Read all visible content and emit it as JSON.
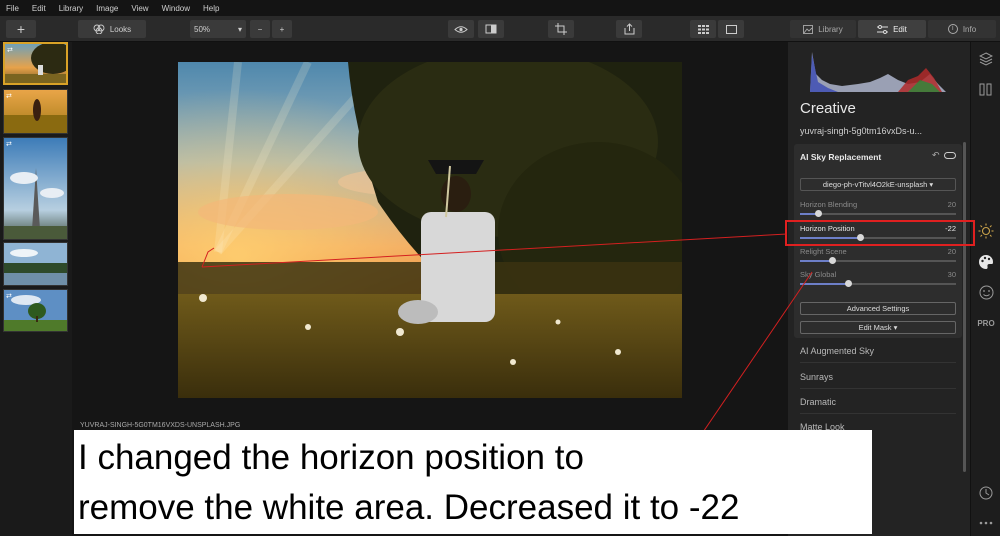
{
  "menu": [
    "File",
    "Edit",
    "Library",
    "Image",
    "View",
    "Window",
    "Help"
  ],
  "toolbar": {
    "looks_label": "Looks",
    "zoom_value": "50%",
    "tabs": [
      "Library",
      "Edit",
      "Info"
    ]
  },
  "filmstrip": {
    "thumb_badges": [
      "⇄",
      "⇄",
      "⇄",
      "",
      "⇄"
    ]
  },
  "photo": {
    "filename": "YUVRAJ-SINGH-5G0TM16VXDS-UNSPLASH.JPG"
  },
  "panel": {
    "section_title": "Creative",
    "file_name": "yuvraj-singh-5g0tm16vxDs-u...",
    "tool": {
      "title": "AI Sky Replacement",
      "sky_select": "diego-ph-vTitvl4O2kE-unsplash",
      "sliders": [
        {
          "label": "Horizon Blending",
          "value": "20",
          "fraction": 0.12,
          "active": false
        },
        {
          "label": "Horizon Position",
          "value": "-22",
          "fraction": 0.39,
          "active": true
        },
        {
          "label": "Relight Scene",
          "value": "20",
          "fraction": 0.21,
          "active": false
        },
        {
          "label": "Sky Global",
          "value": "30",
          "fraction": 0.31,
          "active": false
        }
      ],
      "advanced_label": "Advanced Settings",
      "edit_mask_label": "Edit Mask"
    },
    "filters": [
      "AI Augmented Sky",
      "Sunrays",
      "Dramatic",
      "Matte Look"
    ]
  },
  "iconbar": {
    "pro_label": "PRO"
  },
  "callout": {
    "line1": "I changed the horizon position to",
    "line2": "remove the white area. Decreased it to -22"
  },
  "colors": {
    "accent": "#6d7fc8",
    "highlight": "#e02020",
    "selected_thumb": "#d9a227"
  }
}
